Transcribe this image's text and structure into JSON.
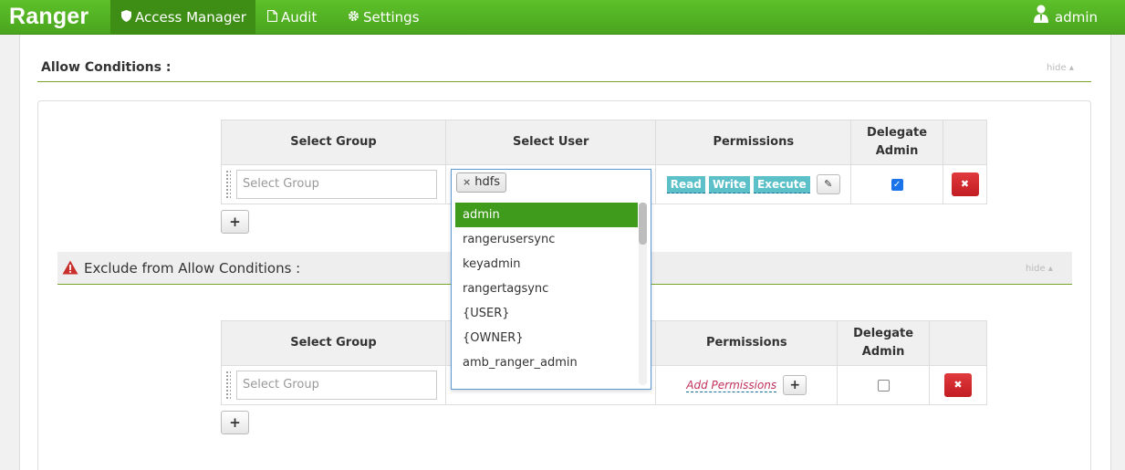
{
  "navbar": {
    "brand": "Ranger",
    "items": [
      {
        "label": "Access Manager",
        "icon": "shield-icon"
      },
      {
        "label": "Audit",
        "icon": "file-icon"
      },
      {
        "label": "Settings",
        "icon": "gear-icon"
      }
    ],
    "user": "admin"
  },
  "allow": {
    "title": "Allow Conditions :",
    "hide": "hide",
    "headers": {
      "group": "Select Group",
      "user": "Select User",
      "permissions": "Permissions",
      "delegate": "Delegate Admin"
    },
    "row": {
      "group_placeholder": "Select Group",
      "selected_user": "hdfs",
      "permissions": [
        "Read",
        "Write",
        "Execute"
      ],
      "delegate_admin": true
    }
  },
  "exclude": {
    "title": "Exclude from Allow Conditions :",
    "hide": "hide",
    "headers": {
      "group": "Select Group",
      "permissions": "Permissions",
      "delegate": "Delegate Admin"
    },
    "row": {
      "group_placeholder": "Select Group",
      "add_permissions": "Add Permissions",
      "delegate_admin": false
    }
  },
  "user_dropdown": {
    "options": [
      "admin",
      "rangerusersync",
      "keyadmin",
      "rangertagsync",
      "{USER}",
      "{OWNER}",
      "amb_ranger_admin"
    ],
    "highlighted": "admin"
  },
  "colors": {
    "brand_green": "#49a51e",
    "highlight": "#3e9b1b",
    "perm_tag": "#5bc0c8",
    "delete": "#c21d22"
  }
}
